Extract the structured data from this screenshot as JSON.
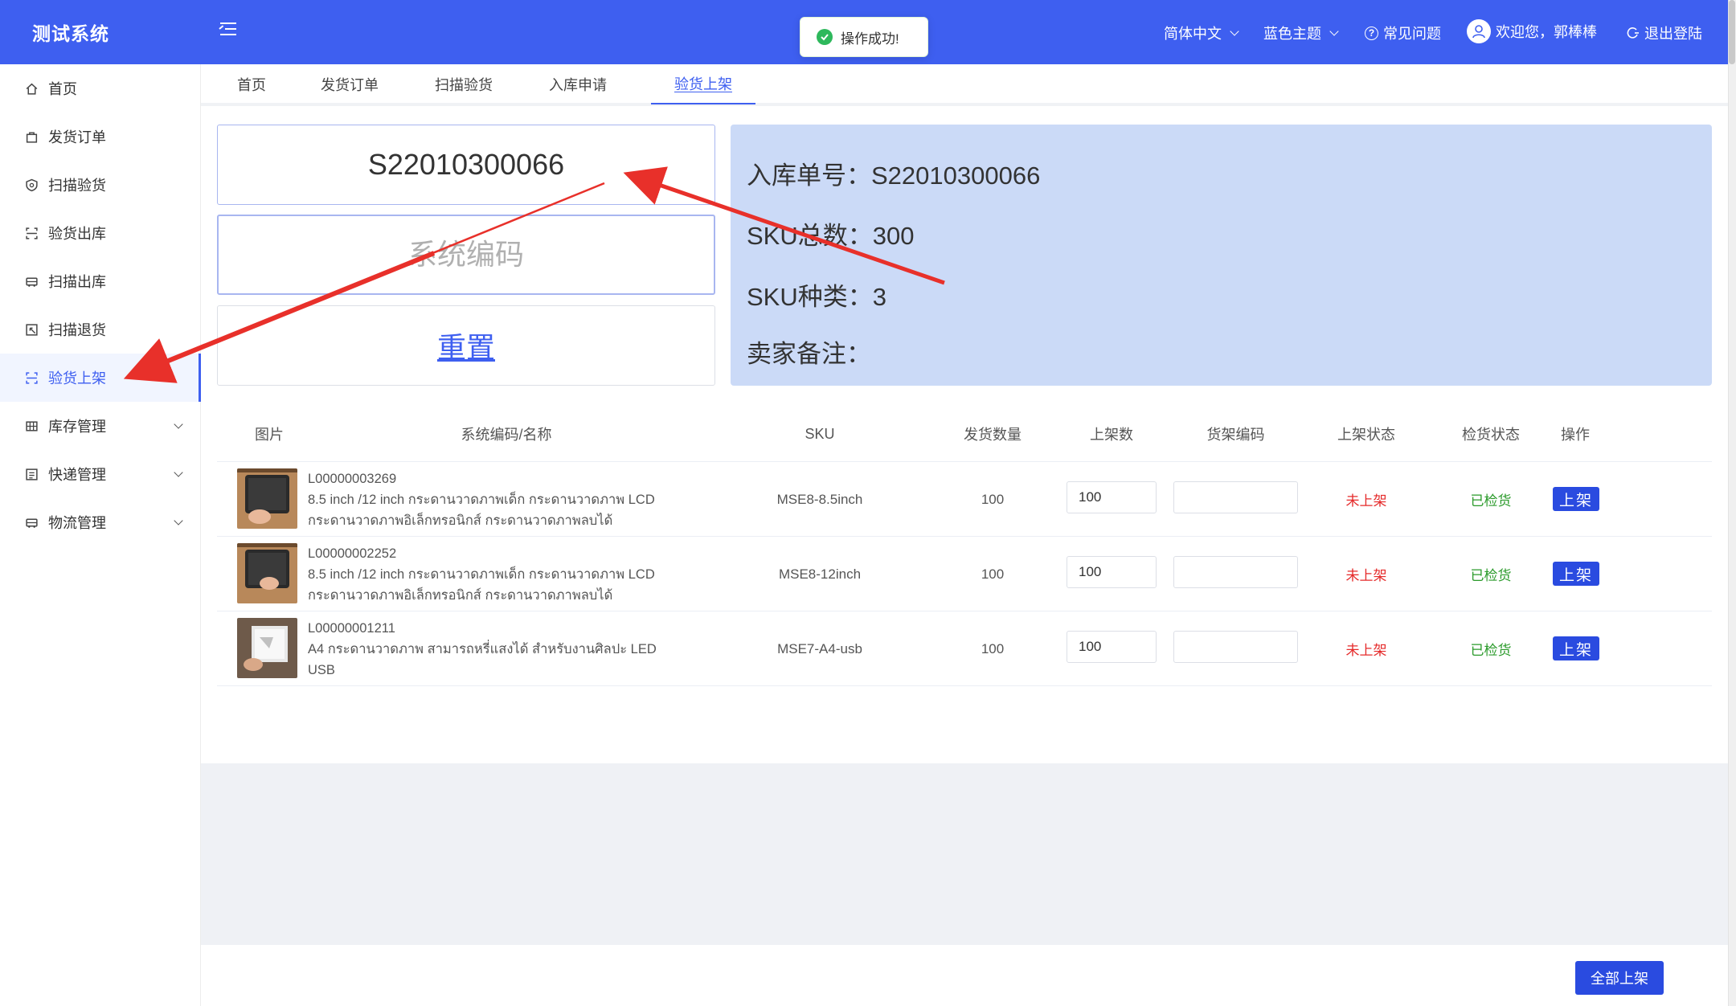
{
  "app": {
    "title": "测试系统"
  },
  "header": {
    "language": "简体中文",
    "theme": "蓝色主题",
    "faq": "常见问题",
    "welcome": "欢迎您，郭棒棒",
    "logout": "退出登陆"
  },
  "toast": {
    "message": "操作成功!"
  },
  "sidebar": {
    "items": [
      {
        "label": "首页"
      },
      {
        "label": "发货订单"
      },
      {
        "label": "扫描验货"
      },
      {
        "label": "验货出库"
      },
      {
        "label": "扫描出库"
      },
      {
        "label": "扫描退货"
      },
      {
        "label": "验货上架",
        "active": true
      },
      {
        "label": "库存管理",
        "expandable": true
      },
      {
        "label": "快递管理",
        "expandable": true
      },
      {
        "label": "物流管理",
        "expandable": true
      }
    ]
  },
  "tabs": [
    {
      "label": "首页"
    },
    {
      "label": "发货订单"
    },
    {
      "label": "扫描验货"
    },
    {
      "label": "入库申请"
    },
    {
      "label": "验货上架",
      "active": true
    }
  ],
  "form": {
    "order_no_value": "S22010300066",
    "code_placeholder": "系统编码",
    "reset_label": "重置"
  },
  "info": {
    "order_no": "入库单号：S22010300066",
    "sku_total": "SKU总数：300",
    "sku_kinds": "SKU种类：3",
    "seller_note": "卖家备注："
  },
  "table": {
    "headers": [
      "图片",
      "系统编码/名称",
      "SKU",
      "发货数量",
      "上架数",
      "货架编码",
      "上架状态",
      "检货状态",
      "操作"
    ],
    "rows": [
      {
        "code": "L00000003269",
        "name_line1": "8.5 inch /12 inch กระดานวาดภาพเด็ก กระดานวาดภาพ LCD",
        "name_line2": "กระดานวาดภาพอิเล็กทรอนิกส์ กระดานวาดภาพลบได้",
        "sku": "MSE8-8.5inch",
        "ship_qty": "100",
        "shelf_qty": "100",
        "shelf_code": "",
        "shelf_status": "未上架",
        "check_status": "已检货",
        "action": "上架"
      },
      {
        "code": "L00000002252",
        "name_line1": "8.5 inch /12 inch กระดานวาดภาพเด็ก กระดานวาดภาพ LCD",
        "name_line2": "กระดานวาดภาพอิเล็กทรอนิกส์ กระดานวาดภาพลบได้",
        "sku": "MSE8-12inch",
        "ship_qty": "100",
        "shelf_qty": "100",
        "shelf_code": "",
        "shelf_status": "未上架",
        "check_status": "已检货",
        "action": "上架"
      },
      {
        "code": "L00000001211",
        "name_line1": "A4 กระดานวาดภาพ สามารถหรี่แสงได้ สำหรับงานศิลปะ LED",
        "name_line2": "USB",
        "sku": "MSE7-A4-usb",
        "ship_qty": "100",
        "shelf_qty": "100",
        "shelf_code": "",
        "shelf_status": "未上架",
        "check_status": "已检货",
        "action": "上架"
      }
    ]
  },
  "footer": {
    "all_shelf_label": "全部上架"
  },
  "colors": {
    "primary": "#3e5ff0",
    "button": "#2a4be0",
    "info_panel": "#cbdaf7",
    "status_red": "#e52a2a",
    "status_green": "#2a9a2a",
    "annotation_arrow": "#e8302a"
  }
}
